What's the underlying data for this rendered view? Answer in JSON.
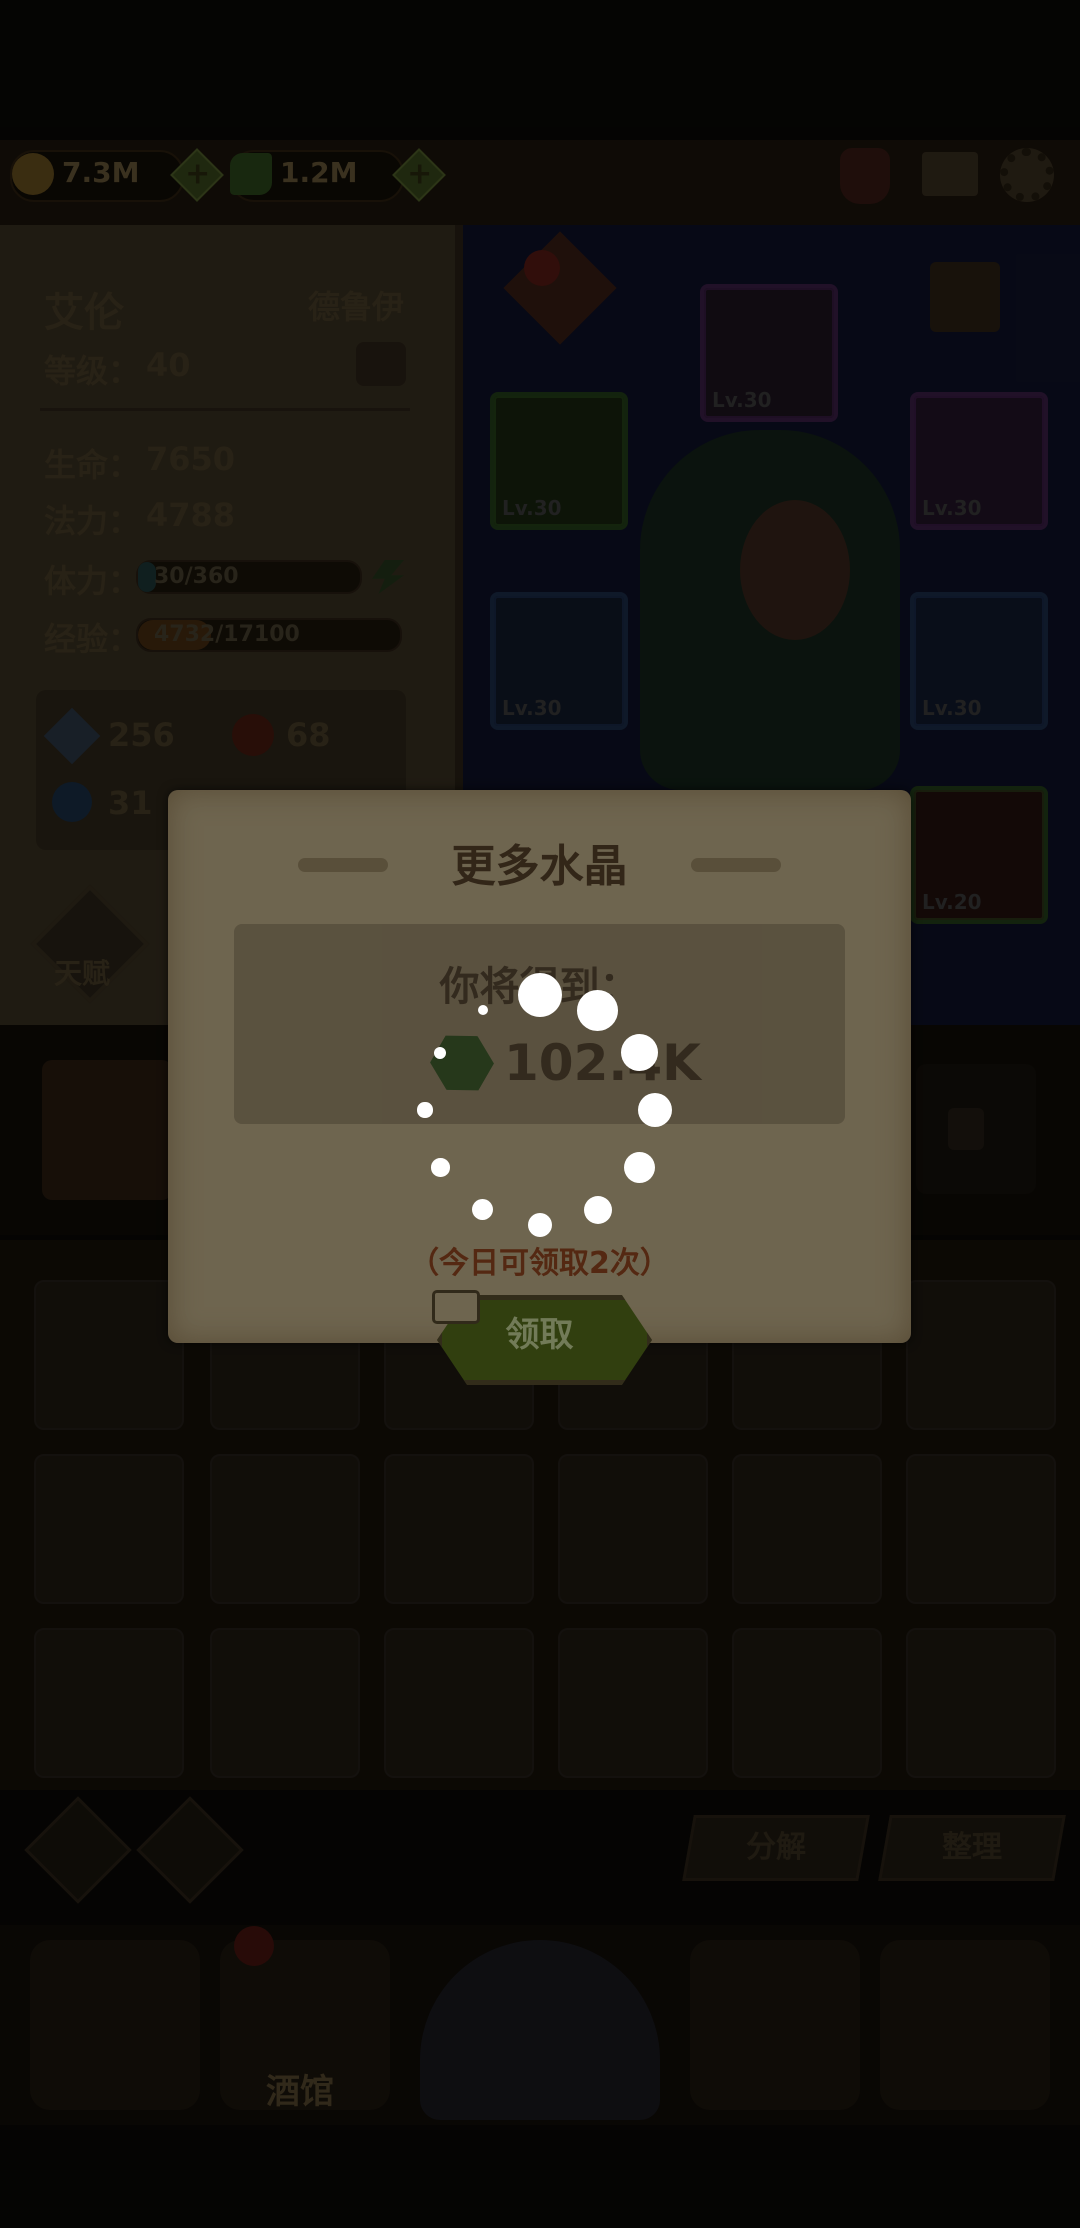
{
  "top_bar": {
    "gold": "7.3M",
    "crystal": "1.2M"
  },
  "hero_panel": {
    "name": "艾伦",
    "class": "德鲁伊",
    "level_label": "等级：",
    "level_value": "40",
    "hp_label": "生命：",
    "hp_value": "7650",
    "mp_label": "法力：",
    "mp_value": "4788",
    "stamina_label": "体力：",
    "stamina_value": "30/360",
    "stamina_fraction": 0.0833,
    "exp_label": "经验：",
    "exp_value": "4732/17100",
    "exp_fraction": 0.277,
    "attack": "256",
    "fire": "68",
    "ice": "31",
    "talent_label": "天赋"
  },
  "equipment": [
    {
      "level": "Lv.30",
      "color": "#6b2f86"
    },
    {
      "level": "Lv.30",
      "color": "#3e7a2c"
    },
    {
      "level": "Lv.30",
      "color": "#6b2f86"
    },
    {
      "level": "Lv.30",
      "color": "#2c4f8a"
    },
    {
      "level": "Lv.30",
      "color": "#2c4f8a"
    },
    {
      "level": "Lv.20",
      "color": "#3e7a2c"
    }
  ],
  "bag": {
    "decompose_label": "分解",
    "sort_label": "整理"
  },
  "bottom_nav": {
    "tavern_label": "酒馆"
  },
  "modal": {
    "title": "更多水晶",
    "reward_label": "你将得到：",
    "reward_amount": "102.4K",
    "limit_text": "（今日可领取2次）",
    "claim_label": "领取"
  },
  "colors": {
    "accent_green": "#59731d",
    "limit_text": "#9a4a22"
  }
}
